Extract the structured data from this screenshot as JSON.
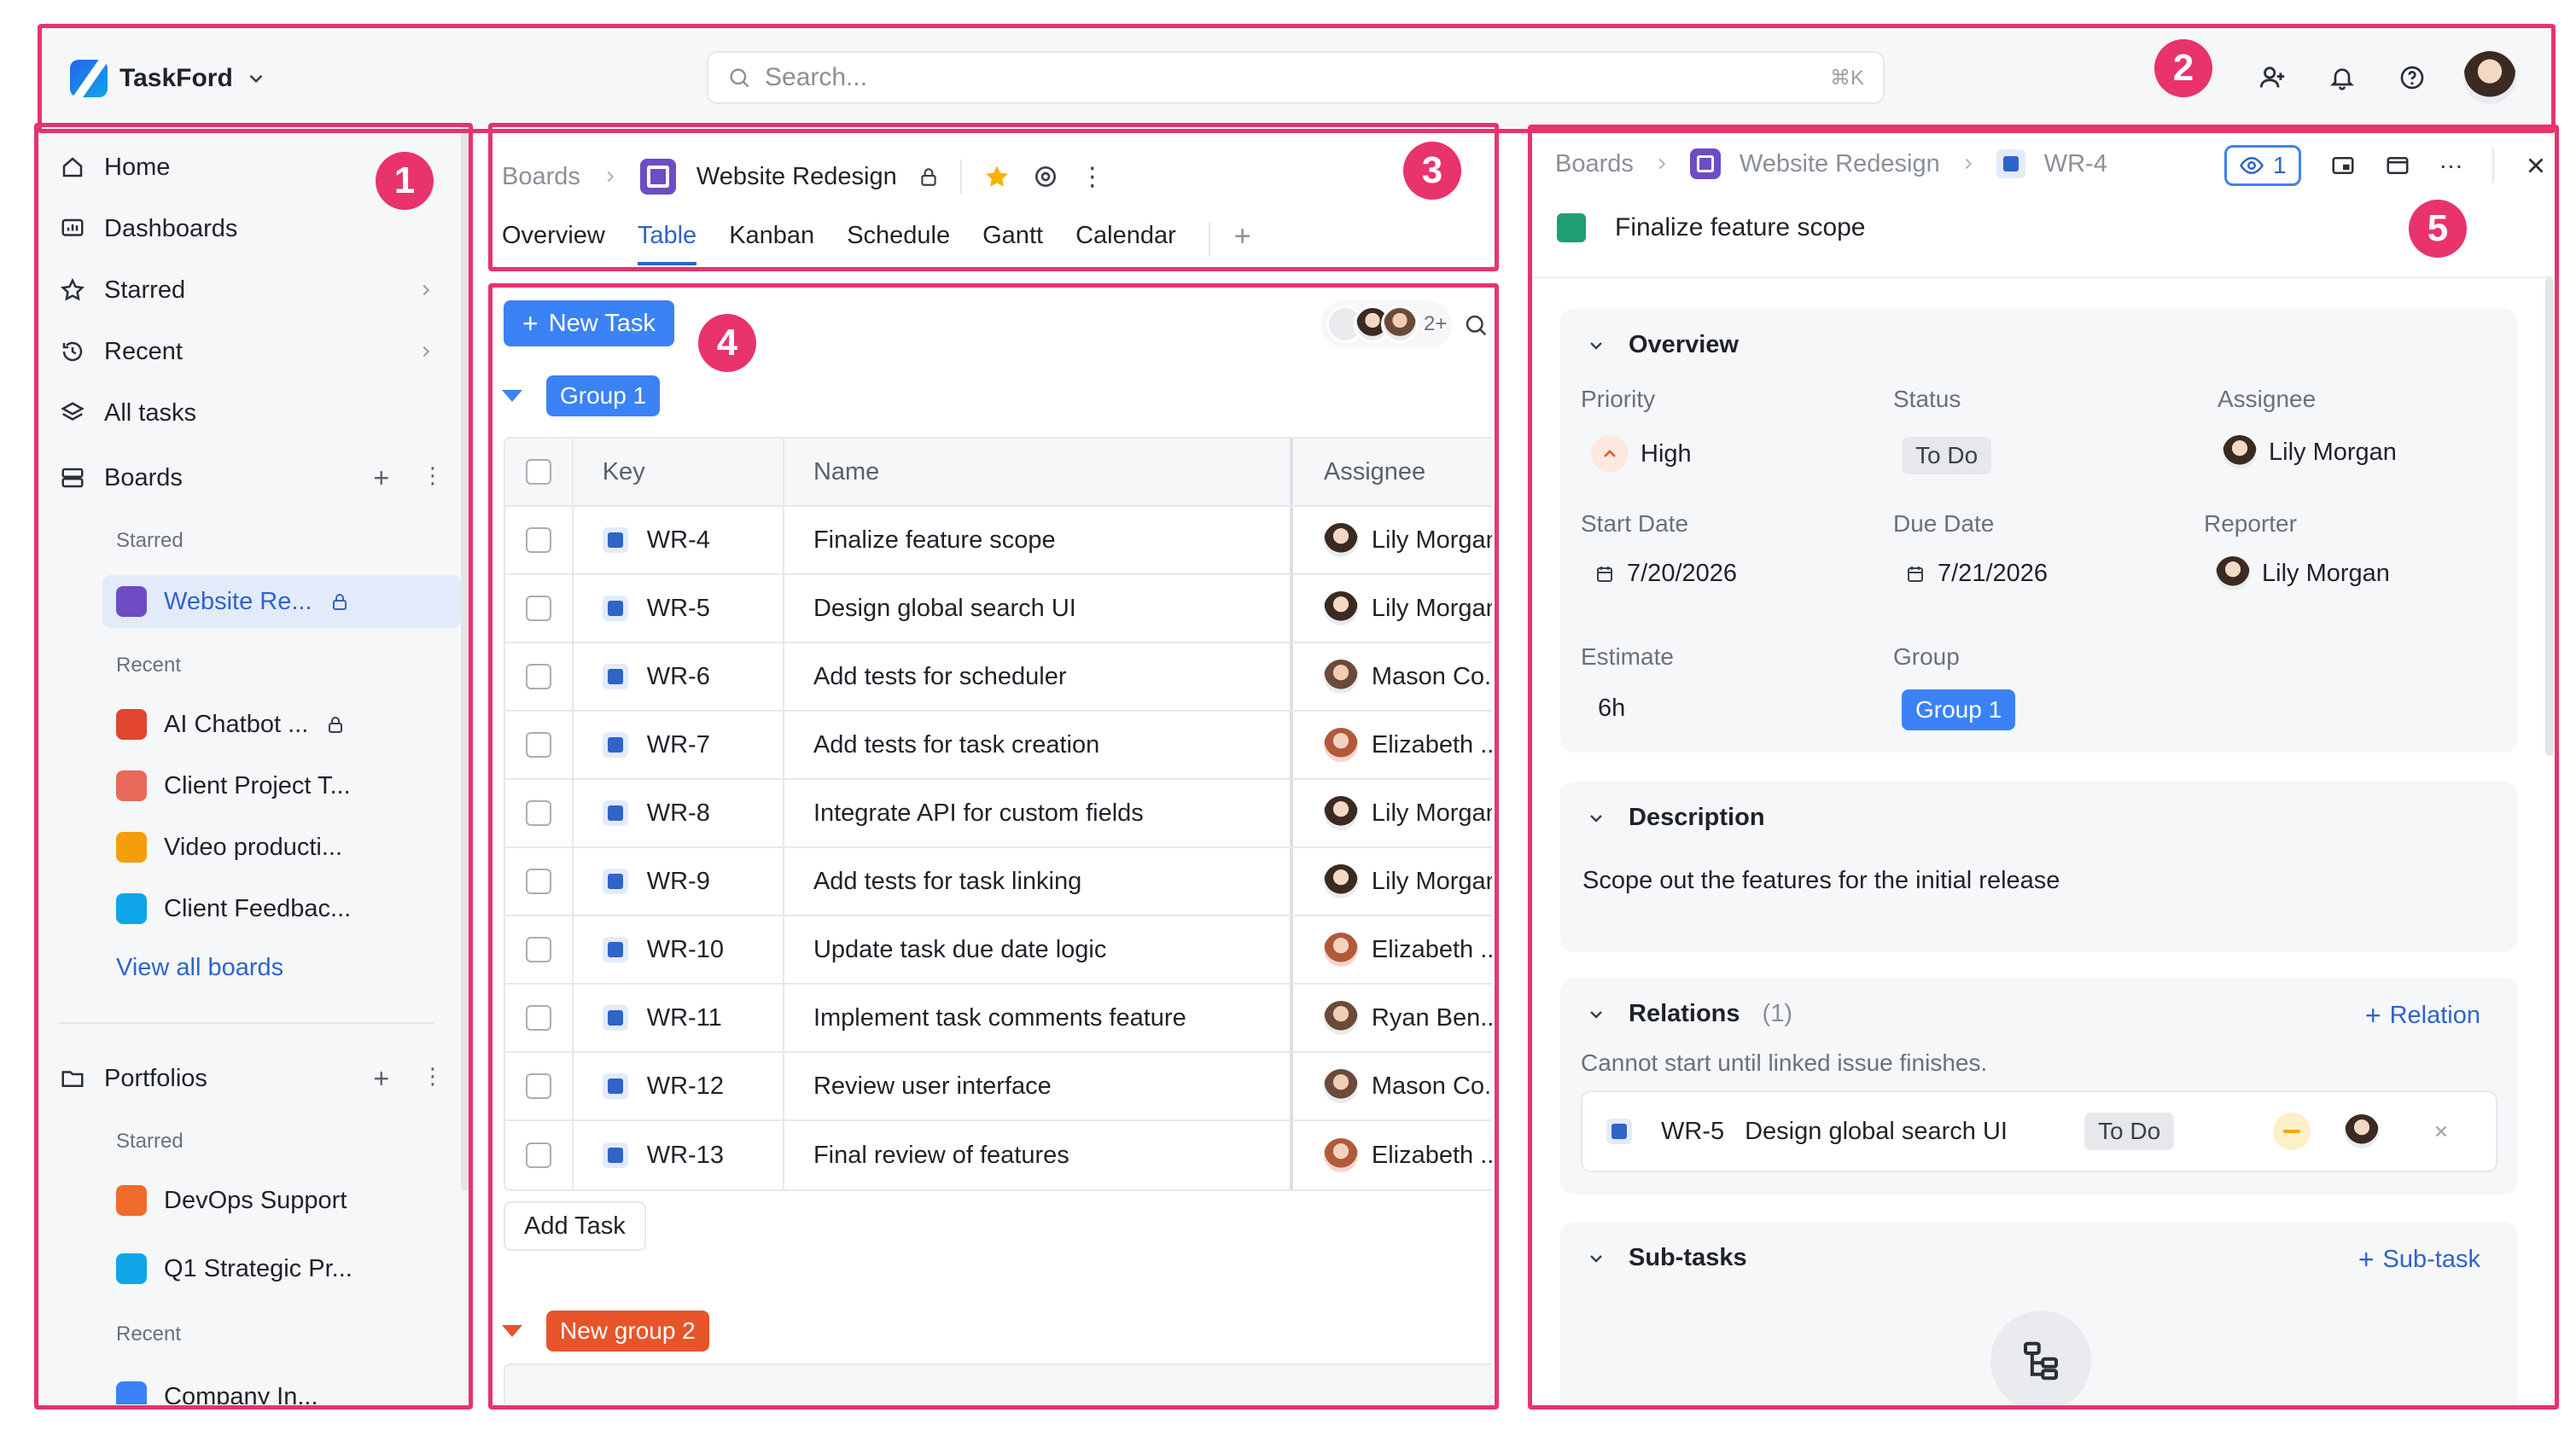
{
  "app": {
    "brand_name": "TaskFord",
    "search_placeholder": "Search...",
    "search_shortcut": "⌘K"
  },
  "annotations": [
    "1",
    "2",
    "3",
    "4",
    "5"
  ],
  "sidebar": {
    "nav": [
      {
        "label": "Home",
        "icon": "home-icon"
      },
      {
        "label": "Dashboards",
        "icon": "dashboard-icon"
      },
      {
        "label": "Starred",
        "icon": "star-icon"
      },
      {
        "label": "Recent",
        "icon": "history-icon"
      },
      {
        "label": "All tasks",
        "icon": "layers-icon"
      }
    ],
    "boards_label": "Boards",
    "starred_label": "Starred",
    "recent_label": "Recent",
    "starred_boards": [
      {
        "label": "Website Re...",
        "color": "#6d4cc4"
      }
    ],
    "recent_boards": [
      {
        "label": "AI Chatbot ...",
        "color": "#e0452f"
      },
      {
        "label": "Client Project T...",
        "color": "#e86a5a"
      },
      {
        "label": "Video producti...",
        "color": "#f59e0b"
      },
      {
        "label": "Client Feedbac...",
        "color": "#0ea5e9"
      }
    ],
    "view_all": "View all boards",
    "portfolios_label": "Portfolios",
    "portfolio_starred_label": "Starred",
    "portfolio_recent_label": "Recent",
    "portfolio_starred": [
      {
        "label": "DevOps Support",
        "color": "#ef6c2c"
      },
      {
        "label": "Q1 Strategic Pr...",
        "color": "#0ea5e9"
      }
    ],
    "portfolio_recent": [
      {
        "label": "Company In...",
        "color": "#3b82f6"
      }
    ]
  },
  "board": {
    "crumb_root": "Boards",
    "title": "Website Redesign",
    "tabs": [
      "Overview",
      "Table",
      "Kanban",
      "Schedule",
      "Gantt",
      "Calendar"
    ],
    "active_tab": "Table"
  },
  "table": {
    "new_task": "New Task",
    "group1": "Group 1",
    "group2": "New group 2",
    "more_assignees": "2+",
    "columns": [
      "Key",
      "Name",
      "Assignee"
    ],
    "rows": [
      {
        "key": "WR-4",
        "name": "Finalize feature scope",
        "assignee": "Lily Morgan"
      },
      {
        "key": "WR-5",
        "name": "Design global search UI",
        "assignee": "Lily Morgan"
      },
      {
        "key": "WR-6",
        "name": "Add tests for scheduler",
        "assignee": "Mason Co..."
      },
      {
        "key": "WR-7",
        "name": "Add tests for task creation",
        "assignee": "Elizabeth ..."
      },
      {
        "key": "WR-8",
        "name": "Integrate API for custom fields",
        "assignee": "Lily Morgan"
      },
      {
        "key": "WR-9",
        "name": "Add tests for task linking",
        "assignee": "Lily Morgan"
      },
      {
        "key": "WR-10",
        "name": "Update task due date logic",
        "assignee": "Elizabeth ..."
      },
      {
        "key": "WR-11",
        "name": "Implement task comments feature",
        "assignee": "Ryan Ben..."
      },
      {
        "key": "WR-12",
        "name": "Review user interface",
        "assignee": "Mason Co..."
      },
      {
        "key": "WR-13",
        "name": "Final review of features",
        "assignee": "Elizabeth ..."
      }
    ],
    "add_task": "Add Task"
  },
  "detail": {
    "crumb_root": "Boards",
    "crumb_board": "Website Redesign",
    "crumb_key": "WR-4",
    "watchers": "1",
    "title": "Finalize feature scope",
    "overview": {
      "heading": "Overview",
      "priority_label": "Priority",
      "priority": "High",
      "status_label": "Status",
      "status": "To Do",
      "assignee_label": "Assignee",
      "assignee": "Lily Morgan",
      "start_label": "Start Date",
      "start": "7/20/2026",
      "due_label": "Due Date",
      "due": "7/21/2026",
      "reporter_label": "Reporter",
      "reporter": "Lily Morgan",
      "estimate_label": "Estimate",
      "estimate": "6h",
      "group_label": "Group",
      "group": "Group 1"
    },
    "description": {
      "heading": "Description",
      "text": "Scope out the features for the initial release"
    },
    "relations": {
      "heading": "Relations",
      "count": "(1)",
      "action": "Relation",
      "note": "Cannot start until linked issue finishes.",
      "item_key": "WR-5",
      "item_name": "Design global search UI",
      "item_status": "To Do"
    },
    "subtasks": {
      "heading": "Sub-tasks",
      "action": "Sub-task"
    }
  },
  "colors": {
    "accent": "#3b82f6",
    "annotation": "#e8336b",
    "group2": "#e8542a",
    "task_color": "#1e9e74"
  }
}
